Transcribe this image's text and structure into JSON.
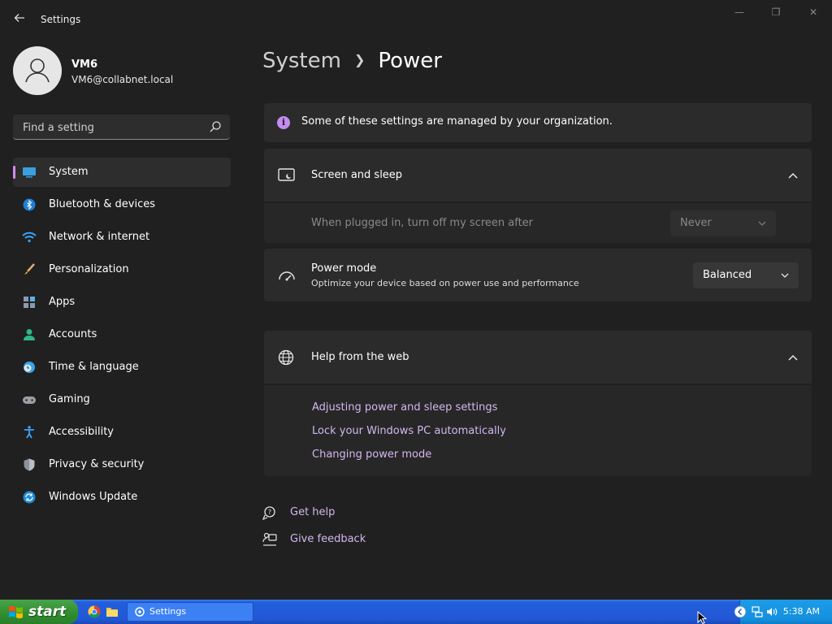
{
  "window": {
    "title": "Settings",
    "controls": {
      "minimize": "—",
      "maximize": "❐",
      "close": "✕"
    }
  },
  "profile": {
    "name": "VM6",
    "email": "VM6@collabnet.local"
  },
  "search": {
    "placeholder": "Find a setting"
  },
  "sidebar": {
    "items": [
      {
        "label": "System",
        "icon": "system-icon",
        "active": true
      },
      {
        "label": "Bluetooth & devices",
        "icon": "bluetooth-icon"
      },
      {
        "label": "Network & internet",
        "icon": "wifi-icon"
      },
      {
        "label": "Personalization",
        "icon": "brush-icon"
      },
      {
        "label": "Apps",
        "icon": "apps-icon"
      },
      {
        "label": "Accounts",
        "icon": "person-icon"
      },
      {
        "label": "Time & language",
        "icon": "clock-globe-icon"
      },
      {
        "label": "Gaming",
        "icon": "controller-icon"
      },
      {
        "label": "Accessibility",
        "icon": "accessibility-icon"
      },
      {
        "label": "Privacy & security",
        "icon": "shield-icon"
      },
      {
        "label": "Windows Update",
        "icon": "update-icon"
      }
    ]
  },
  "breadcrumb": {
    "parent": "System",
    "current": "Power"
  },
  "notice": {
    "text": "Some of these settings are managed by your organization."
  },
  "screen_sleep": {
    "title": "Screen and sleep",
    "setting_label": "When plugged in, turn off my screen after",
    "setting_value": "Never"
  },
  "power_mode": {
    "title": "Power mode",
    "description": "Optimize your device based on power use and performance",
    "value": "Balanced"
  },
  "help": {
    "title": "Help from the web",
    "links": [
      "Adjusting power and sleep settings",
      "Lock your Windows PC automatically",
      "Changing power mode"
    ]
  },
  "footer": {
    "get_help": "Get help",
    "give_feedback": "Give feedback"
  },
  "taskbar": {
    "start_label": "start",
    "task_label": "Settings",
    "clock": "5:38 AM"
  },
  "colors": {
    "accent": "#c48cf0",
    "link": "#d2b7f0",
    "background": "#202020",
    "card": "#2b2b2b"
  }
}
